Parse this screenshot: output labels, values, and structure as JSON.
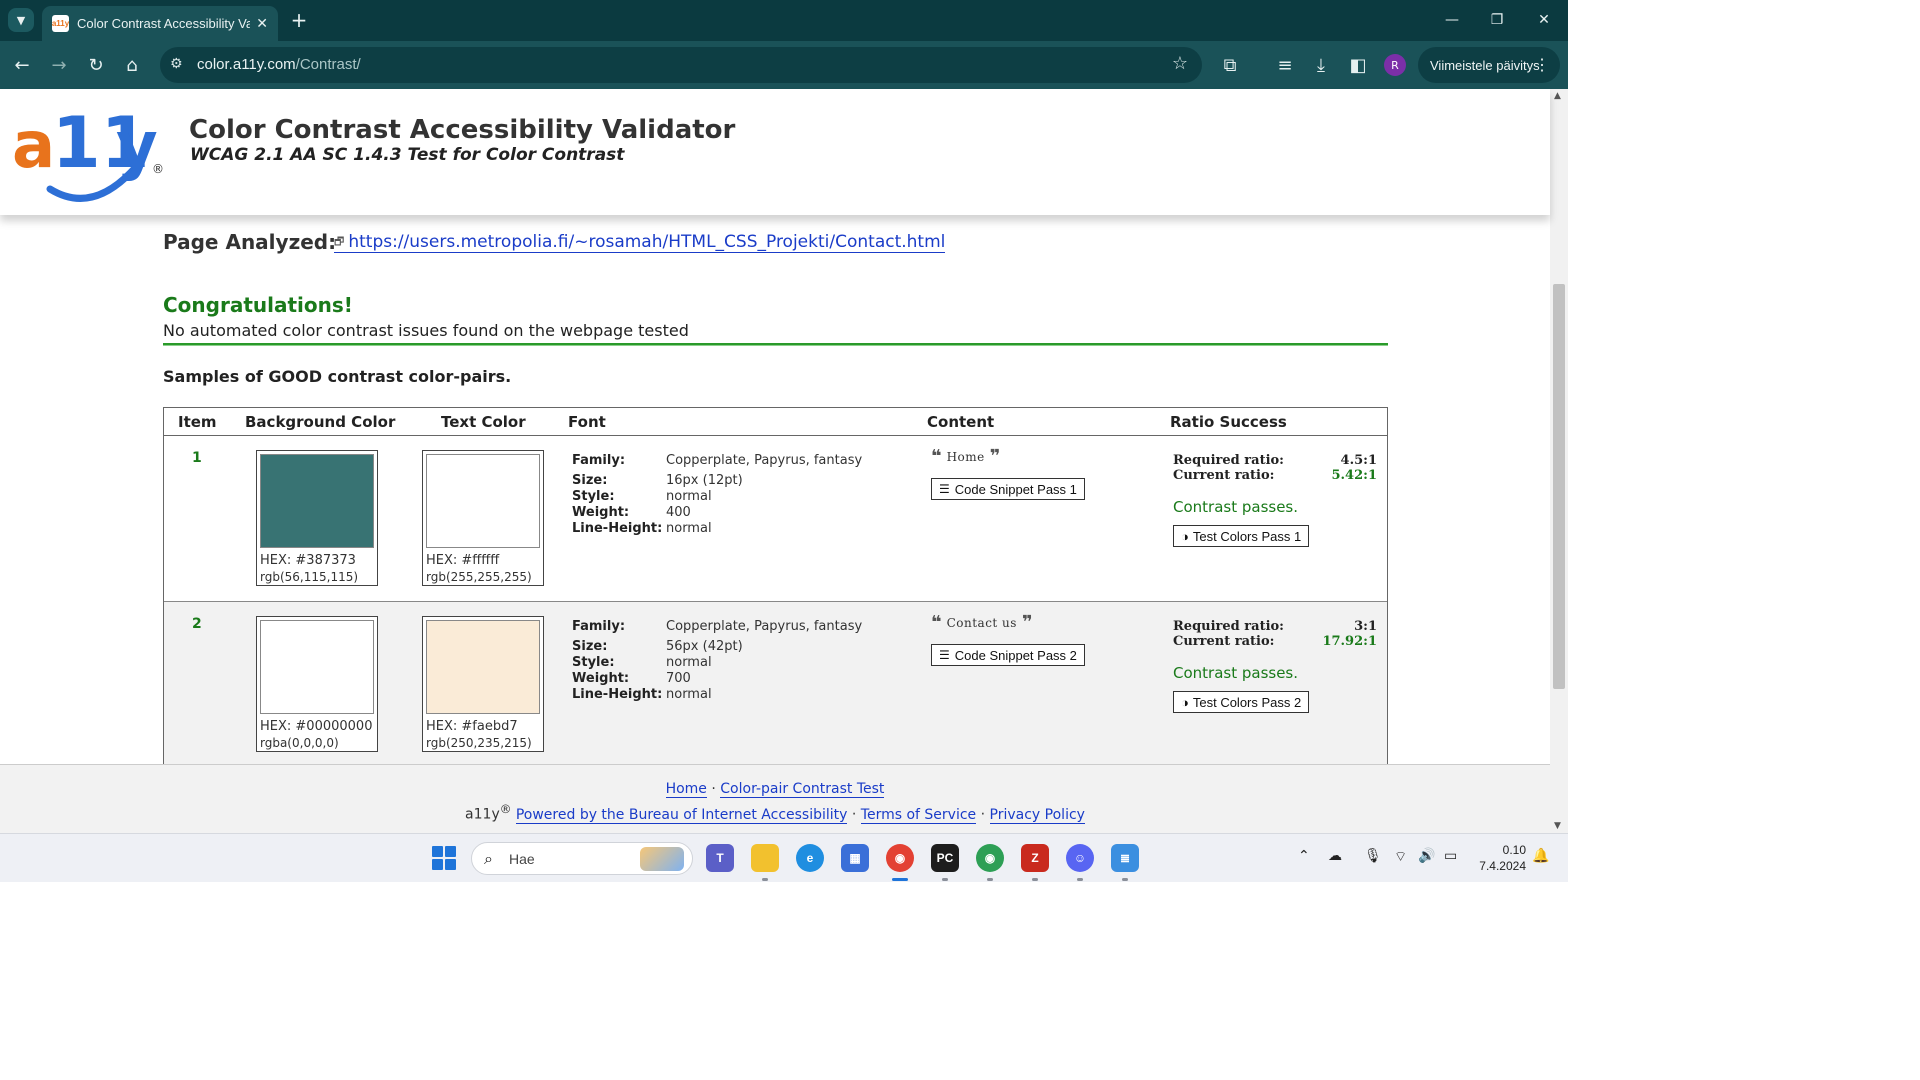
{
  "browser": {
    "tab_title": "Color Contrast Accessibility Vali",
    "url_host": "color.a11y.com",
    "url_path": "/Contrast/",
    "profile_initial": "R",
    "update_label": "Viimeistele päivitys"
  },
  "header": {
    "logo_text": "a11y",
    "title": "Color Contrast Accessibility Validator",
    "subtitle": "WCAG 2.1 AA SC 1.4.3 Test for Color Contrast"
  },
  "report": {
    "page_analyzed_label": "Page Analyzed:",
    "page_url": "https://users.metropolia.fi/~rosamah/HTML_CSS_Projekti/Contact.html",
    "congrats": "Congratulations!",
    "no_issues": "No automated color contrast issues found on the webpage tested",
    "samples_heading": "Samples of GOOD contrast color-pairs."
  },
  "table": {
    "headers": [
      "Item",
      "Background Color",
      "Text Color",
      "Font",
      "Content",
      "Ratio Success"
    ],
    "font_labels": {
      "family": "Family:",
      "size": "Size:",
      "style": "Style:",
      "weight": "Weight:",
      "line_height": "Line-Height:"
    },
    "ratio_labels": {
      "required": "Required ratio:",
      "current": "Current ratio:"
    },
    "rows": [
      {
        "item": "1",
        "bg_color": "#387373",
        "bg_hex": "HEX: #387373",
        "bg_rgb": "rgb(56,115,115)",
        "text_color": "#ffffff",
        "text_hex": "HEX: #ffffff",
        "text_rgb": "rgb(255,255,255)",
        "family": "Copperplate, Papyrus, fantasy",
        "size": "16px (12pt)",
        "style": "normal",
        "weight": "400",
        "line_height": "normal",
        "content": "Home",
        "snippet_label": "Code Snippet Pass 1",
        "required_ratio": "4.5:1",
        "current_ratio": "5.42:1",
        "passes": "Contrast passes.",
        "test_label": "Test Colors Pass 1"
      },
      {
        "item": "2",
        "bg_color": "#ffffff",
        "bg_hex": "HEX: #00000000",
        "bg_rgb": "rgba(0,0,0,0)",
        "text_color": "#faebd7",
        "text_hex": "HEX: #faebd7",
        "text_rgb": "rgb(250,235,215)",
        "family": "Copperplate, Papyrus, fantasy",
        "size": "56px (42pt)",
        "style": "normal",
        "weight": "700",
        "line_height": "normal",
        "content": "Contact us",
        "snippet_label": "Code Snippet Pass 2",
        "required_ratio": "3:1",
        "current_ratio": "17.92:1",
        "passes": "Contrast passes.",
        "test_label": "Test Colors Pass 2"
      }
    ]
  },
  "footer": {
    "home": "Home",
    "sep": "·",
    "color_pair": "Color-pair Contrast Test",
    "brand": "a11y",
    "reg": "®",
    "powered": "Powered by the Bureau of Internet Accessibility",
    "terms": "Terms of Service",
    "privacy": "Privacy Policy"
  },
  "taskbar": {
    "search_placeholder": "Hae",
    "time": "0.10",
    "date": "7.4.2024"
  },
  "colors": {
    "brand_orange": "#e8731c",
    "brand_blue": "#2d6fd6",
    "pass_green": "#1a7a1a",
    "link_blue": "#1a3cc8",
    "chrome_dark": "#0b3a40",
    "chrome_toolbar": "#1a5258"
  },
  "icons": {
    "tab_menu": "chevron-down-icon",
    "close": "close-icon",
    "new_tab": "plus-icon",
    "back": "arrow-left-icon",
    "forward": "arrow-right-icon",
    "reload": "reload-icon",
    "home": "home-icon",
    "site_info": "tune-icon",
    "bookmark": "star-icon",
    "extensions": "puzzle-icon",
    "downloads": "download-icon",
    "quote_open": "quote-open-icon",
    "quote_close": "quote-close-icon",
    "snippet": "lines-icon",
    "contrast": "half-circle-icon"
  }
}
